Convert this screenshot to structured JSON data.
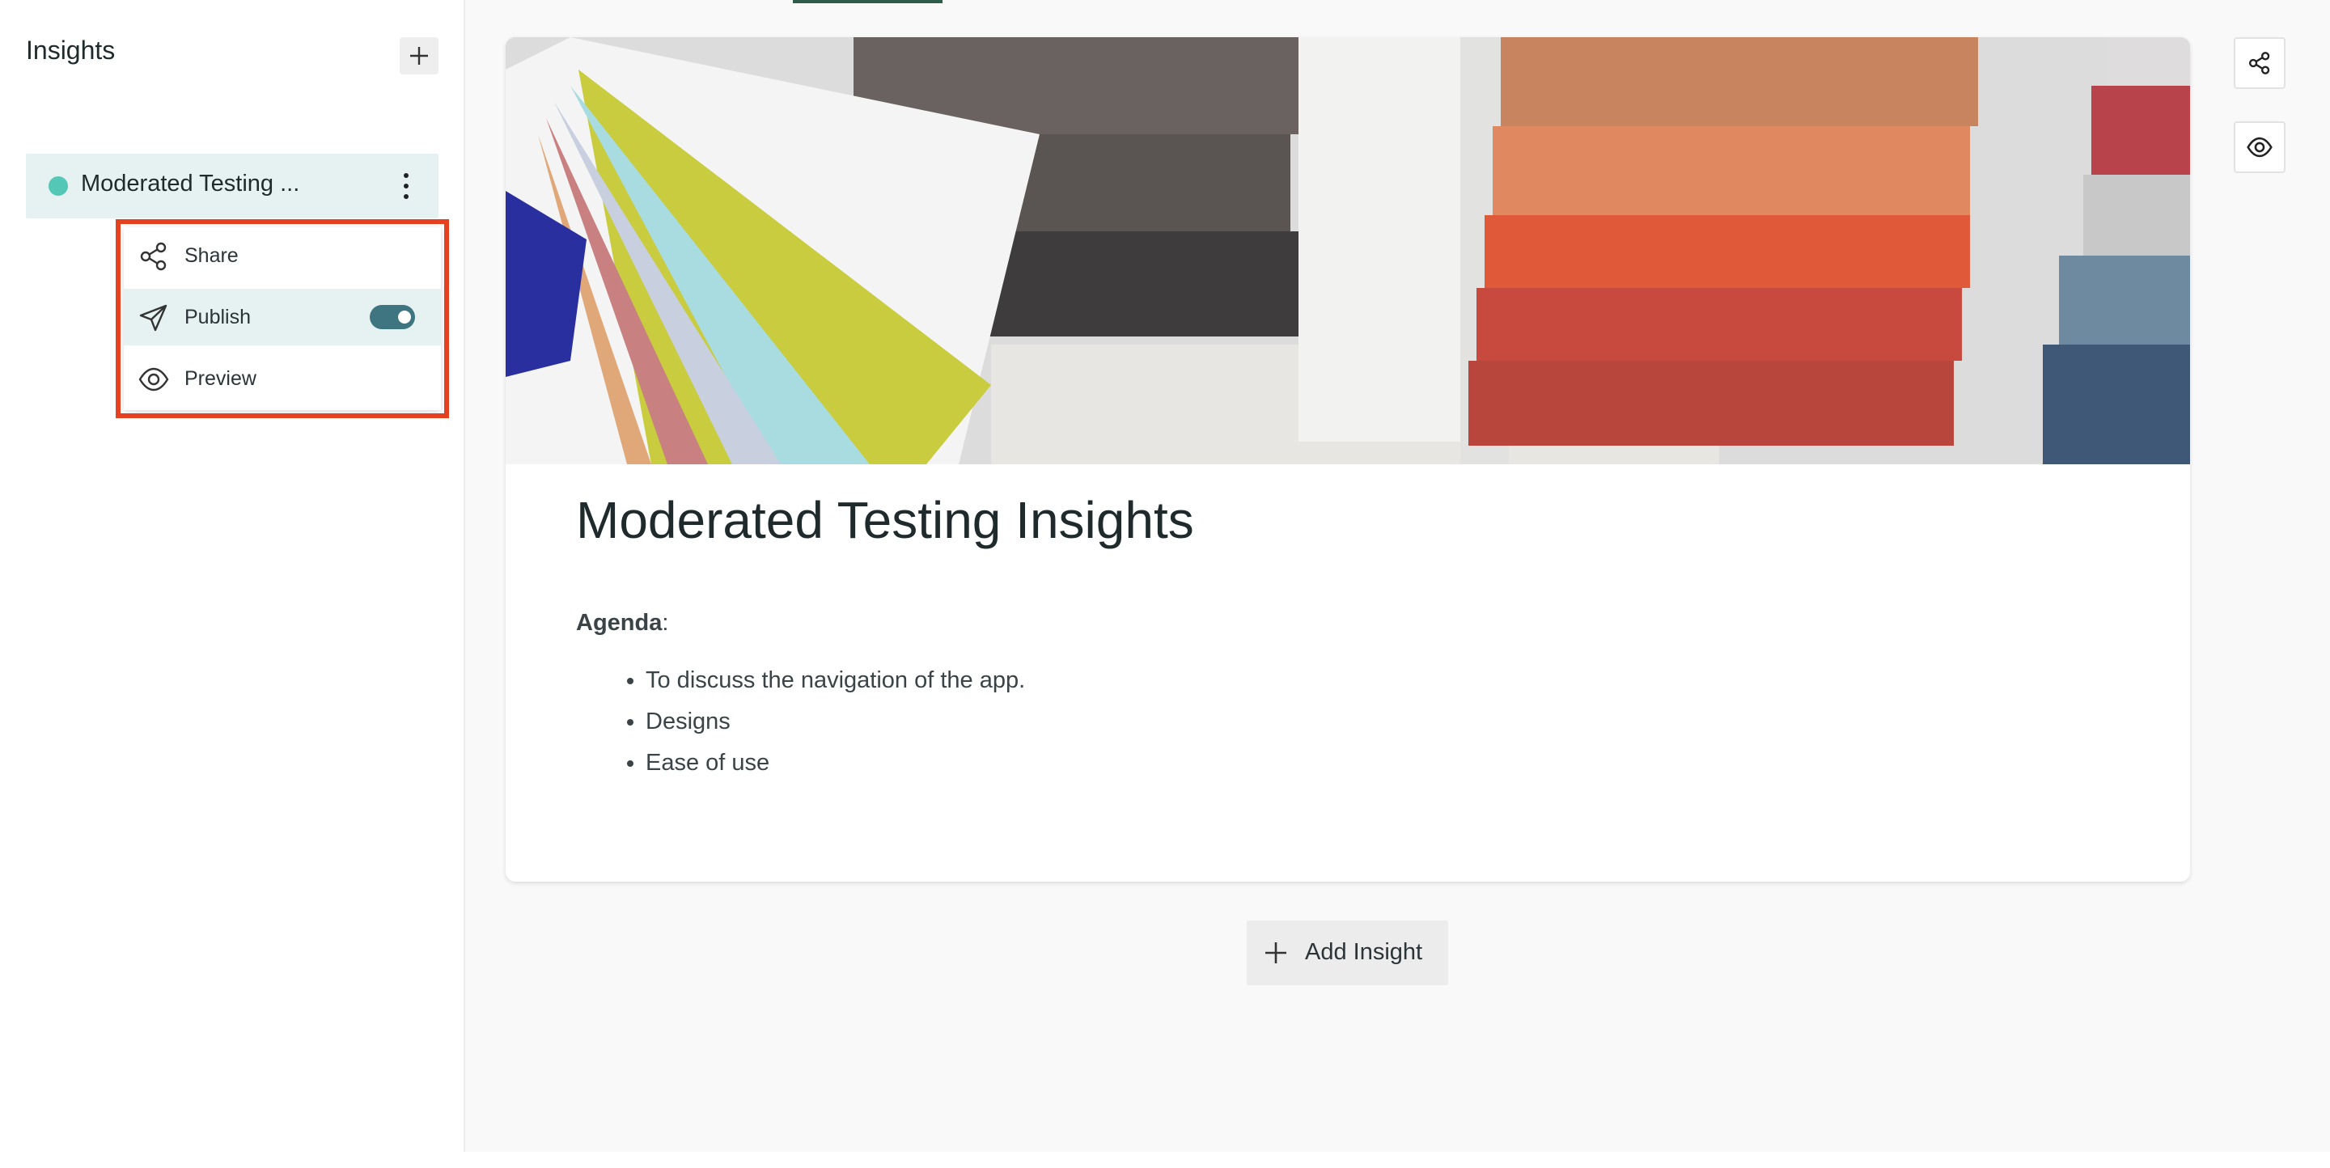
{
  "sidebar": {
    "title": "Insights",
    "add_icon": "plus-icon",
    "items": [
      {
        "label": "Moderated Testing ...",
        "status_color": "#55c7b6",
        "menu_icon": "kebab-icon"
      }
    ]
  },
  "context_menu": {
    "items": [
      {
        "label": "Share",
        "icon": "share-icon"
      },
      {
        "label": "Publish",
        "icon": "send-icon",
        "toggle_on": true
      },
      {
        "label": "Preview",
        "icon": "eye-icon"
      }
    ],
    "highlight_color": "#e5401f"
  },
  "main": {
    "card": {
      "cover_image": "fabric-swatches-photo",
      "title": "Moderated Testing Insights",
      "agenda_label": "Agenda",
      "agenda_suffix": ":",
      "agenda_items": [
        "To discuss the navigation of the app.",
        "Designs",
        "Ease of use"
      ]
    },
    "add_insight_label": "Add Insight",
    "side_actions": [
      "share-icon",
      "eye-icon"
    ]
  },
  "colors": {
    "accent": "#3e7580",
    "selected_bg": "#e6f1f1",
    "status_dot": "#55c7b6"
  }
}
